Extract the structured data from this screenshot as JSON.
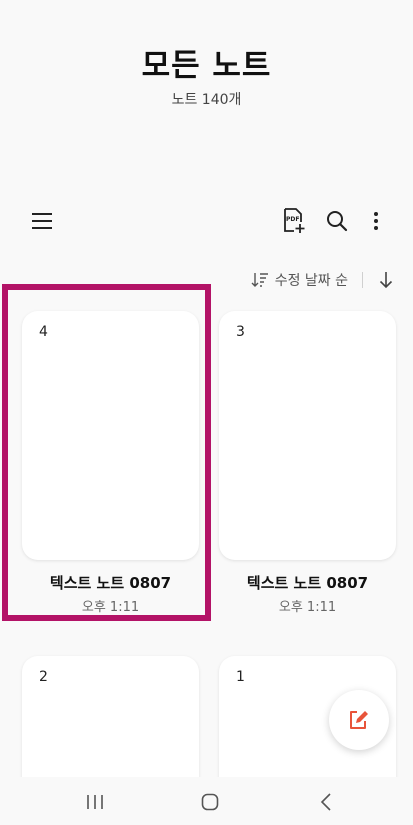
{
  "header": {
    "title": "모든 노트",
    "count": "노트 140개"
  },
  "toolbar": {
    "menu_icon": "hamburger-menu-icon",
    "pdf_icon": "pdf-add-icon",
    "search_icon": "search-icon",
    "more_icon": "more-vertical-icon"
  },
  "sort": {
    "label": "수정 날짜 순",
    "direction_icon": "arrow-down-icon"
  },
  "notes": [
    {
      "number": "4",
      "title": "텍스트 노트 0807",
      "time": "오후 1:11"
    },
    {
      "number": "3",
      "title": "텍스트 노트 0807",
      "time": "오후 1:11"
    },
    {
      "number": "2"
    },
    {
      "number": "1"
    }
  ],
  "fab": {
    "icon": "compose-note-icon"
  },
  "colors": {
    "highlight": "#b31367",
    "fab_accent": "#e8543a"
  }
}
